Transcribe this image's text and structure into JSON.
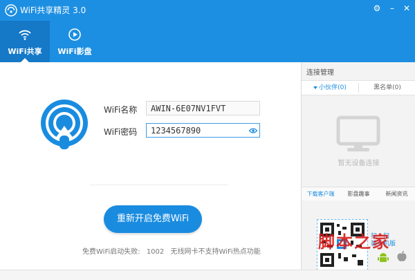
{
  "window": {
    "title": "WiFi共享精灵 3.0",
    "buttons": [
      "settings",
      "minimize",
      "close"
    ]
  },
  "nav": {
    "tabs": [
      {
        "label": "WiFi共享",
        "icon": "wifi-icon",
        "active": true
      },
      {
        "label": "WiFi影盘",
        "icon": "play-icon",
        "active": false
      }
    ]
  },
  "main": {
    "name_label": "WiFi名称",
    "name_value": "AWIN-6E07NV1FVT",
    "password_label": "WiFi密码",
    "password_value": "1234567890",
    "restart_button": "重新开启免费WiFi",
    "status_text": "免费WiFi启动失败:",
    "error_code": "1002",
    "error_message": "无线网卡不支持WiFi热点功能"
  },
  "sidebar": {
    "title": "连接管理",
    "tabs": [
      {
        "label": "小伙伴(0)",
        "active": true
      },
      {
        "label": "黑名单(0)",
        "active": false
      }
    ],
    "empty_message": "暂无设备连接",
    "bottom_tabs": [
      {
        "label": "下载客户端",
        "active": true
      },
      {
        "label": "影盘趣事",
        "active": false
      },
      {
        "label": "新闻资讯",
        "active": false
      }
    ],
    "qr_hint_line1": "扫一扫",
    "qr_hint_line2": "装手机版"
  },
  "watermark": "脚本之家",
  "colors": {
    "primary": "#1d8fe2",
    "accent": "#1a8ce0",
    "nav_active": "#1579c8"
  }
}
